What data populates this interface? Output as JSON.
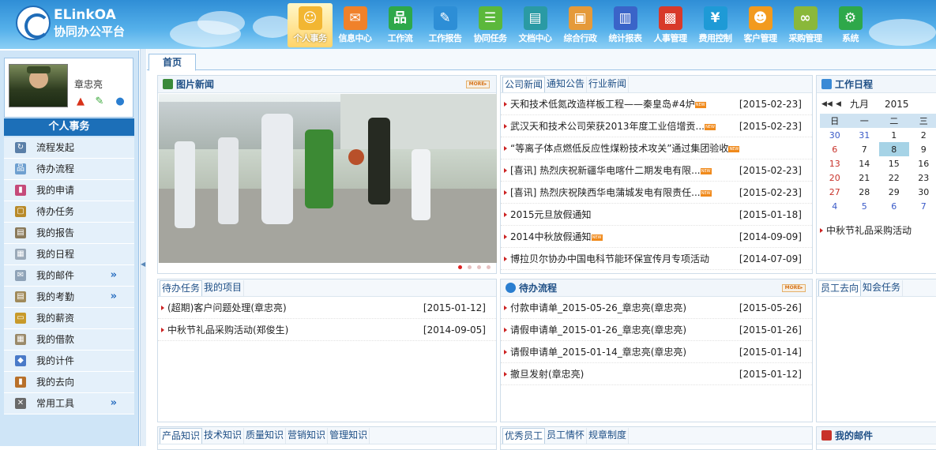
{
  "app": {
    "title_line1": "ELinkOA",
    "title_line2": "协同办公平台"
  },
  "nav": [
    {
      "label": "个人事务",
      "icon": "person-icon",
      "color": "#f2b632",
      "glyph": "☺",
      "active": true
    },
    {
      "label": "信息中心",
      "icon": "chat-icon",
      "color": "#f0812a",
      "glyph": "✉"
    },
    {
      "label": "工作流",
      "icon": "workflow-icon",
      "color": "#2ea84a",
      "glyph": "品"
    },
    {
      "label": "工作报告",
      "icon": "report-icon",
      "color": "#2d8ed6",
      "glyph": "✎"
    },
    {
      "label": "协同任务",
      "icon": "task-icon",
      "color": "#5bb83b",
      "glyph": "☰"
    },
    {
      "label": "文档中心",
      "icon": "folder-icon",
      "color": "#2a9aa4",
      "glyph": "▤"
    },
    {
      "label": "综合行政",
      "icon": "admin-icon",
      "color": "#e59a3a",
      "glyph": "▣"
    },
    {
      "label": "统计报表",
      "icon": "chart-icon",
      "color": "#3a64c8",
      "glyph": "▥"
    },
    {
      "label": "人事管理",
      "icon": "hr-icon",
      "color": "#d83a2a",
      "glyph": "▩"
    },
    {
      "label": "费用控制",
      "icon": "yen-icon",
      "color": "#1e9ad6",
      "glyph": "¥"
    },
    {
      "label": "客户管理",
      "icon": "customer-icon",
      "color": "#f29a1e",
      "glyph": "☻"
    },
    {
      "label": "采购管理",
      "icon": "purchase-icon",
      "color": "#8ab83a",
      "glyph": "∞"
    },
    {
      "label": "系统",
      "icon": "gear-icon",
      "color": "#2ea84a",
      "glyph": "⚙"
    }
  ],
  "user": {
    "name": "章忠亮"
  },
  "menu_title": "个人事务",
  "menu": [
    {
      "label": "流程发起",
      "icon": "process-start-icon",
      "color": "#5a7fa8",
      "glyph": "↻"
    },
    {
      "label": "待办流程",
      "icon": "pending-flow-icon",
      "color": "#6fa0d0",
      "glyph": "品"
    },
    {
      "label": "我的申请",
      "icon": "application-icon",
      "color": "#c54a7a",
      "glyph": "▮"
    },
    {
      "label": "待办任务",
      "icon": "todo-task-icon",
      "color": "#b88a2a",
      "glyph": "▢"
    },
    {
      "label": "我的报告",
      "icon": "my-report-icon",
      "color": "#8a7a5a",
      "glyph": "▤"
    },
    {
      "label": "我的日程",
      "icon": "schedule-icon",
      "color": "#9aa9b8",
      "glyph": "▦"
    },
    {
      "label": "我的邮件",
      "icon": "mail-icon",
      "color": "#8fa3b8",
      "glyph": "✉",
      "expand": true
    },
    {
      "label": "我的考勤",
      "icon": "attendance-icon",
      "color": "#a08a5a",
      "glyph": "▤",
      "expand": true
    },
    {
      "label": "我的薪资",
      "icon": "salary-icon",
      "color": "#c89a2a",
      "glyph": "▭"
    },
    {
      "label": "我的借款",
      "icon": "loan-icon",
      "color": "#9a8a6a",
      "glyph": "▦"
    },
    {
      "label": "我的计件",
      "icon": "piecework-icon",
      "color": "#4a7ac8",
      "glyph": "◆"
    },
    {
      "label": "我的去向",
      "icon": "whereabouts-icon",
      "color": "#b8702a",
      "glyph": "▮"
    },
    {
      "label": "常用工具",
      "icon": "tools-icon",
      "color": "#6a6a6a",
      "glyph": "✕",
      "expand": true
    }
  ],
  "expand_glyph": "»",
  "home_tab": "首页",
  "photo_news": {
    "title": "图片新闻",
    "more": "MORE▸"
  },
  "company_news": {
    "tabs": [
      "公司新闻",
      "通知公告",
      "行业新闻"
    ],
    "items": [
      {
        "text": "天和技术低氮改造样板工程——秦皇岛#4炉",
        "date": "[2015-02-23]",
        "new": true
      },
      {
        "text": "武汉天和技术公司荣获2013年度工业倍增贡...",
        "date": "[2015-02-23]",
        "new": true
      },
      {
        "text": "“等离子体点燃低反应性煤粉技术攻关”通过集团验收",
        "date": "",
        "new": true
      },
      {
        "text": "[喜讯] 热烈庆祝新疆华电喀什二期发电有限...",
        "date": "[2015-02-23]",
        "new": true
      },
      {
        "text": "[喜讯] 热烈庆祝陕西华电蒲城发电有限责任...",
        "date": "[2015-02-23]",
        "new": true
      },
      {
        "text": "2015元旦放假通知",
        "date": "[2015-01-18]",
        "new": false
      },
      {
        "text": "2014中秋放假通知",
        "date": "[2014-09-09]",
        "new": true
      },
      {
        "text": "博拉贝尔协办中国电科节能环保宣传月专项活动",
        "date": "[2014-07-09]",
        "new": false
      }
    ]
  },
  "schedule": {
    "title": "工作日程",
    "nav_prev": "◀◀",
    "nav_prev1": "◀",
    "month": "九月",
    "year": "2015",
    "weekdays": [
      "日",
      "一",
      "二",
      "三"
    ],
    "weeks": [
      [
        "30",
        "31",
        "1",
        "2"
      ],
      [
        "6",
        "7",
        "8",
        "9"
      ],
      [
        "13",
        "14",
        "15",
        "16"
      ],
      [
        "20",
        "21",
        "22",
        "23"
      ],
      [
        "27",
        "28",
        "29",
        "30"
      ],
      [
        "4",
        "5",
        "6",
        "7"
      ]
    ],
    "event": "中秋节礼品采购活动"
  },
  "todo_tasks": {
    "tabs": [
      "待办任务",
      "我的项目"
    ],
    "items": [
      {
        "text": "(超期)客户问题处理(章忠亮)",
        "date": "[2015-01-12]"
      },
      {
        "text": "中秋节礼品采购活动(郑俊生)",
        "date": "[2014-09-05]"
      }
    ]
  },
  "pending_flow": {
    "title": "待办流程",
    "more": "MORE▸",
    "items": [
      {
        "text": "付款申请单_2015-05-26_章忠亮(章忠亮)",
        "date": "[2015-05-26]"
      },
      {
        "text": "请假申请单_2015-01-26_章忠亮(章忠亮)",
        "date": "[2015-01-26]"
      },
      {
        "text": "请假申请单_2015-01-14_章忠亮(章忠亮)",
        "date": "[2015-01-14]"
      },
      {
        "text": "撤旦发射(章忠亮)",
        "date": "[2015-01-12]"
      }
    ]
  },
  "staff": {
    "tabs": [
      "员工去向",
      "知会任务"
    ]
  },
  "knowledge": {
    "tabs": [
      "产品知识",
      "技术知识",
      "质量知识",
      "营销知识",
      "管理知识"
    ]
  },
  "employees": {
    "tabs": [
      "优秀员工",
      "员工情怀",
      "规章制度"
    ]
  },
  "my_mail": {
    "title": "我的邮件"
  }
}
